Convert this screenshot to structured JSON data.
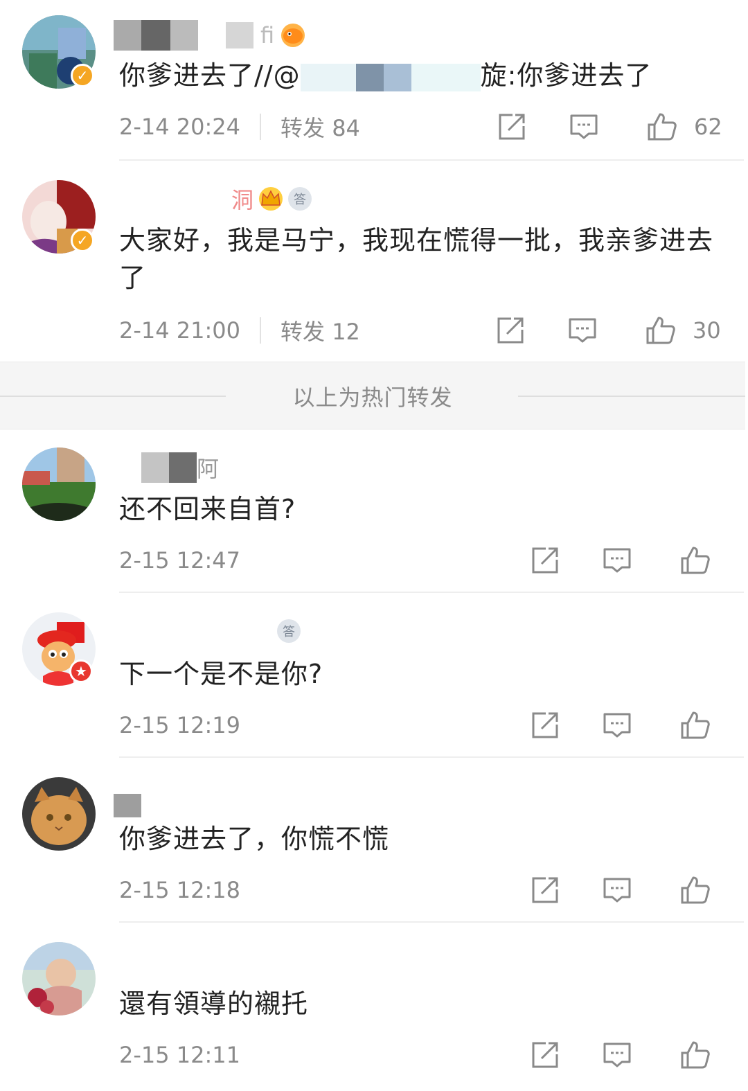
{
  "posts": [
    {
      "avatar": "avatar-blue-figure",
      "badge": "v",
      "username": "fi",
      "text": "你爹进去了//@",
      "text_after": "旋:你爹进去了",
      "time": "2-14 20:24",
      "repost_label": "转发 84",
      "likes": "62"
    },
    {
      "avatar": "avatar-anime-girl",
      "badge": "v",
      "username": "洞",
      "text": "大家好，我是马宁，我现在慌得一批，我亲爹进去了",
      "time": "2-14 21:00",
      "repost_label": "转发 12",
      "likes": "30"
    },
    {
      "avatar": "avatar-stadium",
      "username": "阿",
      "text": "还不回来自首?",
      "time": "2-15 12:47"
    },
    {
      "avatar": "avatar-red-cap-doll",
      "badge": "r",
      "text": "下一个是不是你?",
      "time": "2-15 12:19"
    },
    {
      "avatar": "avatar-orange-cat",
      "text": "你爹进去了，你慌不慌",
      "time": "2-15 12:18"
    },
    {
      "avatar": "avatar-baby",
      "text": "還有領導的襯托",
      "time": "2-15 12:11"
    }
  ],
  "hot_divider_label": "以上为热门转发",
  "badge_icons": {
    "v": "✓",
    "r": "★"
  },
  "medal_char": "答",
  "colors": {
    "verified": "#f5a623",
    "red_badge": "#e8372f",
    "meta": "#8a8a8a"
  }
}
